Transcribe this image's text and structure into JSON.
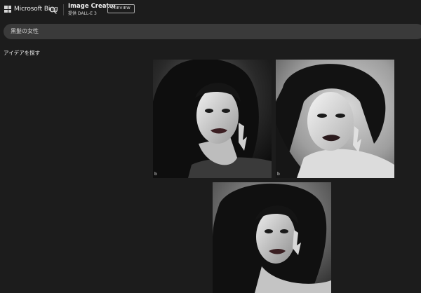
{
  "header": {
    "brand_name": "Microsoft Bing",
    "product_title": "Image Creator",
    "product_subtitle": "提供 DALL-E 3",
    "preview_label": "PREVIEW"
  },
  "prompt": {
    "text": "黒髪の女性"
  },
  "ideas_label": "アイデアを探す",
  "images": [
    {
      "alt": "黒髪の女性",
      "mark": "b"
    },
    {
      "alt": "黒髪の女性",
      "mark": "b"
    },
    {
      "alt": "黒髪の女性",
      "mark": ""
    }
  ],
  "colors": {
    "background": "#1c1c1c",
    "prompt_bar": "#3a3a3a",
    "text": "#e6e6e6"
  }
}
